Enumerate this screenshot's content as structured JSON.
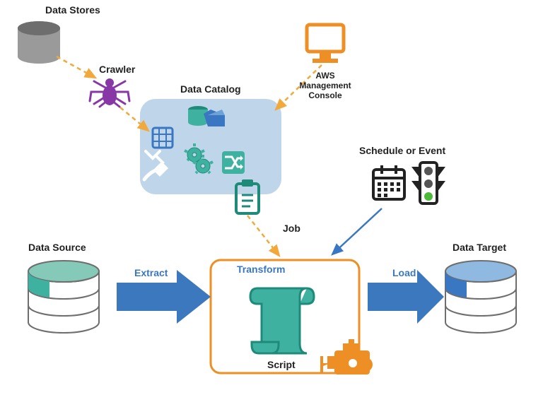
{
  "labels": {
    "data_stores": "Data Stores",
    "crawler": "Crawler",
    "aws_console": "AWS Management\nConsole",
    "data_catalog": "Data Catalog",
    "schedule": "Schedule or Event",
    "job": "Job",
    "data_source": "Data Source",
    "extract": "Extract",
    "transform": "Transform",
    "script": "Script",
    "load": "Load",
    "data_target": "Data Target"
  },
  "colors": {
    "orange": "#ee8f26",
    "dashed": "#f2a93b",
    "teal": "#3eb1a1",
    "teal_dark": "#1d8a7a",
    "blue": "#3a77c2",
    "arrow_blue": "#3b78bd",
    "catalog_bg": "#bfd6ea",
    "purple": "#8837a7",
    "gray": "#6d6e6d",
    "black": "#222"
  }
}
